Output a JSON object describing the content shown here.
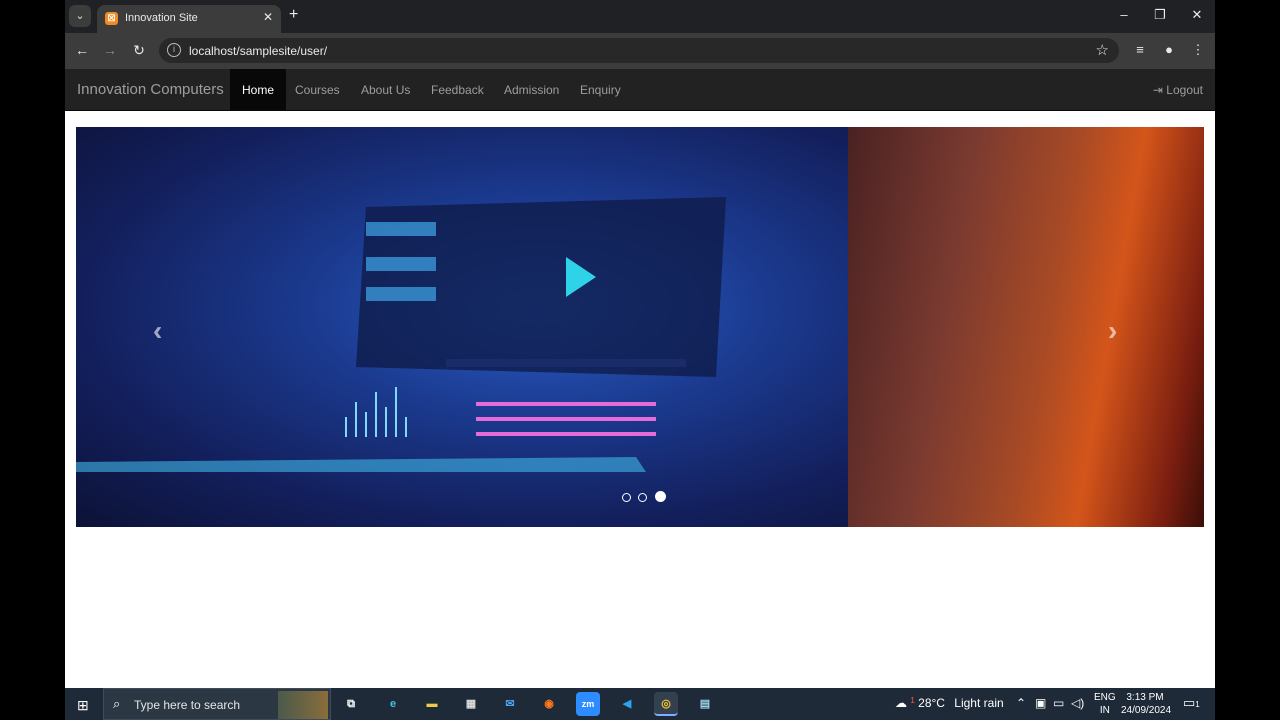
{
  "browser": {
    "tab_title": "Innovation Site",
    "tab_favicon": "xampp-icon",
    "url": "localhost/samplesite/user/"
  },
  "site": {
    "brand": "Innovation Computers",
    "nav": [
      {
        "label": "Home",
        "active": true
      },
      {
        "label": "Courses",
        "active": false
      },
      {
        "label": "About Us",
        "active": false
      },
      {
        "label": "Feedback",
        "active": false
      },
      {
        "label": "Admission",
        "active": false
      },
      {
        "label": "Enquiry",
        "active": false
      }
    ],
    "logout_label": "Logout"
  },
  "carousel": {
    "slide_count": 3,
    "active_index": 2,
    "prev_icon": "chevron-left-icon",
    "next_icon": "chevron-right-icon"
  },
  "taskbar": {
    "search_placeholder": "Type here to search",
    "apps": [
      "task-view-icon",
      "edge-icon",
      "file-explorer-icon",
      "microsoft-store-icon",
      "mail-icon",
      "firefox-icon",
      "zoom-icon",
      "vscode-icon",
      "chrome-icon",
      "notepad-icon"
    ],
    "weather_temp": "28°C",
    "weather_text": "Light rain",
    "weather_badge": "1",
    "lang_line1": "ENG",
    "lang_line2": "IN",
    "time": "3:13 PM",
    "date": "24/09/2024",
    "notification_count": "1"
  }
}
